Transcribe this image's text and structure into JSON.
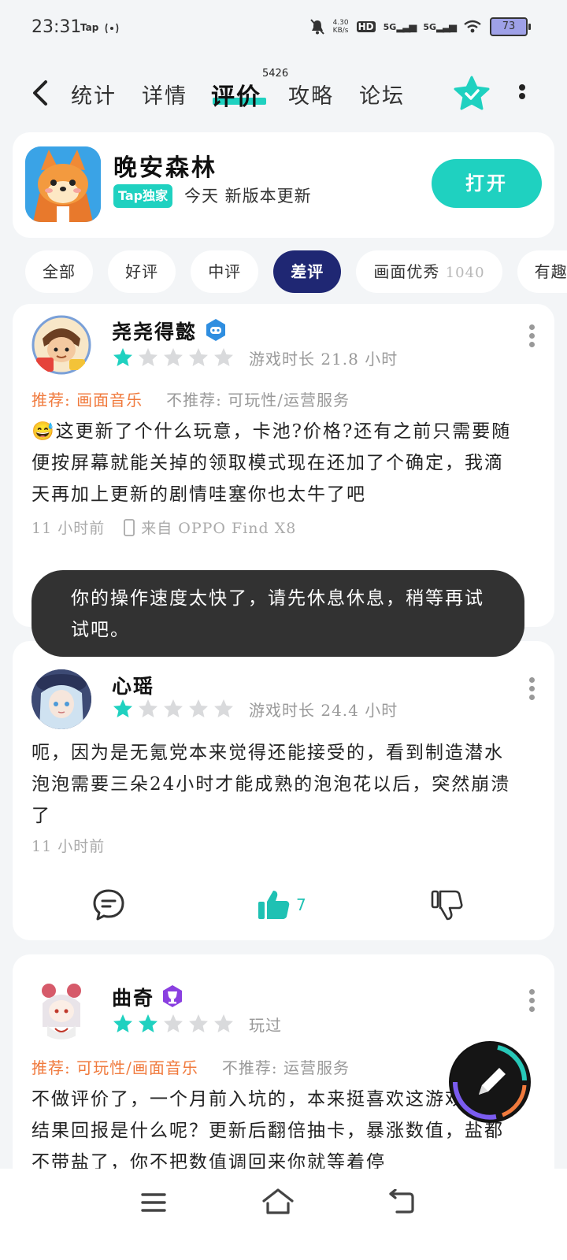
{
  "status_bar": {
    "time": "23:31",
    "tap_label": "Tap",
    "net_speed_value": "4.30",
    "net_speed_unit": "KB/s",
    "battery": "73",
    "signal1": "5G",
    "signal2": "5G",
    "hd": "HD"
  },
  "nav": {
    "tabs": [
      {
        "label": "统计"
      },
      {
        "label": "详情"
      },
      {
        "label": "评价",
        "count": "5426"
      },
      {
        "label": "攻略"
      },
      {
        "label": "论坛"
      }
    ]
  },
  "app": {
    "name": "晚安森林",
    "badge": "Tap独家",
    "subtitle": "今天 新版本更新",
    "open_label": "打开"
  },
  "filters": [
    {
      "label": "全部",
      "count": ""
    },
    {
      "label": "好评",
      "count": ""
    },
    {
      "label": "中评",
      "count": ""
    },
    {
      "label": "差评",
      "count": ""
    },
    {
      "label": "画面优秀",
      "count": "1040"
    },
    {
      "label": "有趣好",
      "count": ""
    }
  ],
  "reviews": [
    {
      "username": "尧尧得懿",
      "rating": 1,
      "meta": "游戏时长 21.8 小时",
      "recommend": "推荐: 画面音乐",
      "not_recommend": "不推荐: 可玩性/运营服务",
      "text": "😅这更新了个什么玩意，卡池?价格?还有之前只需要随便按屏幕就能关掉的领取模式现在还加了个确定，我滴天再加上更新的剧情哇塞你也太牛了吧",
      "time": "11 小时前",
      "device": "来自 OPPO Find X8"
    },
    {
      "username": "心瑶",
      "rating": 1,
      "meta": "游戏时长 24.4 小时",
      "text": "呃，因为是无氪党本来觉得还能接受的，看到制造潜水泡泡需要三朵24小时才能成熟的泡泡花以后，突然崩溃了",
      "time": "11 小时前",
      "likes": "7"
    },
    {
      "username": "曲奇",
      "rating": 2,
      "meta": "玩过",
      "recommend": "推荐: 可玩性/画面音乐",
      "not_recommend": "不推荐: 运营服务",
      "text": "不做评价了，一个月前入坑的，本来挺喜欢这游戏的，结果回报是什么呢？更新后翻倍抽卡，暴涨数值，盐都不带盐了，你不把数值调回来你就等着停"
    }
  ],
  "toast": {
    "message": "你的操作速度太快了，请先休息休息，稍等再试试吧。"
  },
  "colors": {
    "accent": "#1fd1c0",
    "active_chip": "#1f2773",
    "recommend": "#f07a3d",
    "star_on": "#1fd1c0",
    "star_off": "#d9dadc"
  }
}
